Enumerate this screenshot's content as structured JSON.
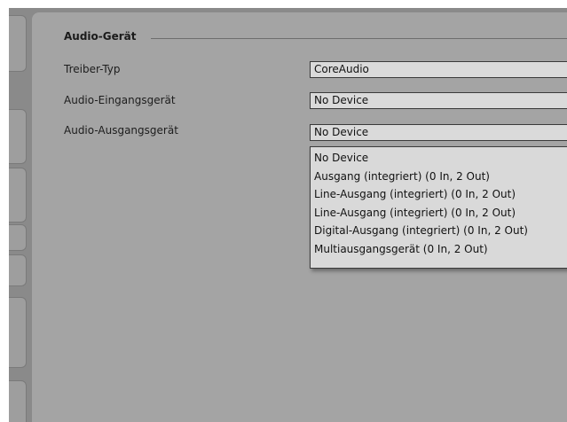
{
  "section": {
    "title": "Audio-Gerät"
  },
  "rows": {
    "driver_type": {
      "label": "Treiber-Typ",
      "value": "CoreAudio"
    },
    "input_device": {
      "label": "Audio-Eingangsgerät",
      "value": "No Device"
    },
    "output_device": {
      "label": "Audio-Ausgangsgerät",
      "value": "No Device"
    }
  },
  "dropdown": {
    "options": [
      "No Device",
      "Ausgang (integriert) (0 In, 2 Out)",
      "Line-Ausgang (integriert) (0 In, 2 Out)",
      "Line-Ausgang (integriert) (0 In, 2 Out)",
      "Digital-Ausgang (integriert) (0 In, 2 Out)",
      "Multiausgangsgerät (0 In, 2 Out)"
    ]
  }
}
